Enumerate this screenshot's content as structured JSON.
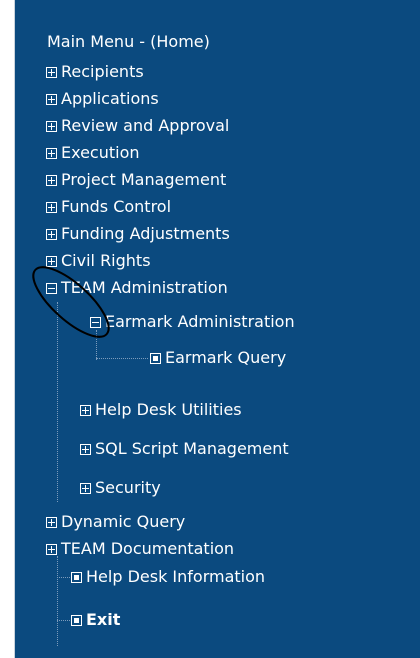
{
  "menu": {
    "title": "Main Menu - (Home)",
    "items": [
      {
        "label": "Recipients",
        "state": "collapsed"
      },
      {
        "label": "Applications",
        "state": "collapsed"
      },
      {
        "label": "Review and Approval",
        "state": "collapsed"
      },
      {
        "label": "Execution",
        "state": "collapsed"
      },
      {
        "label": "Project Management",
        "state": "collapsed"
      },
      {
        "label": "Funds Control",
        "state": "collapsed"
      },
      {
        "label": "Funding Adjustments",
        "state": "collapsed"
      },
      {
        "label": "Civil Rights",
        "state": "collapsed"
      },
      {
        "label": "TEAM Administration",
        "state": "expanded"
      },
      {
        "label": "Earmark Administration",
        "state": "expanded"
      },
      {
        "label": "Earmark Query",
        "state": "leaf"
      },
      {
        "label": "Help Desk Utilities",
        "state": "collapsed"
      },
      {
        "label": "SQL Script Management",
        "state": "collapsed"
      },
      {
        "label": "Security",
        "state": "collapsed"
      },
      {
        "label": "Dynamic Query",
        "state": "collapsed"
      },
      {
        "label": "TEAM Documentation",
        "state": "collapsed"
      },
      {
        "label": "Help Desk Information",
        "state": "leaf"
      },
      {
        "label": "Exit",
        "state": "leaf"
      }
    ]
  },
  "colors": {
    "panel_background": "#0b4a7f",
    "text": "#ffffff",
    "connector": "#7d9cbc",
    "annotation": "#000000"
  }
}
